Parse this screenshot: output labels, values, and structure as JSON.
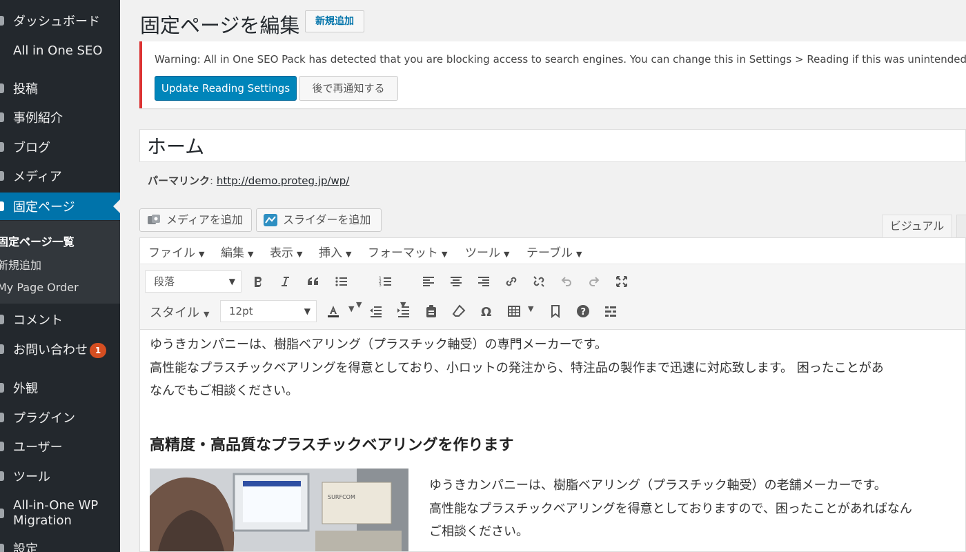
{
  "sidebar": {
    "items": [
      {
        "label": "ダッシュボード"
      },
      {
        "label": "All in One SEO"
      },
      {
        "label": "投稿"
      },
      {
        "label": "事例紹介"
      },
      {
        "label": "ブログ"
      },
      {
        "label": "メディア"
      },
      {
        "label": "固定ページ"
      },
      {
        "label": "コメント"
      },
      {
        "label": "お問い合わせ"
      },
      {
        "label": "外観"
      },
      {
        "label": "プラグイン"
      },
      {
        "label": "ユーザー"
      },
      {
        "label": "ツール"
      },
      {
        "label": "All-in-One WP Migration"
      },
      {
        "label": "設定"
      }
    ],
    "submenu": [
      "固定ページ一覧",
      "新規追加",
      "My Page Order"
    ],
    "badge": "1",
    "active_color": "#0073aa",
    "bg_color": "#23282d"
  },
  "header": {
    "title": "固定ページを編集",
    "add_new": "新規追加"
  },
  "notice": {
    "text": "Warning: All in One SEO Pack has detected that you are blocking access to search engines. You can change this in Settings > Reading if this was unintended.",
    "primary_button": "Update Reading Settings",
    "secondary_button": "後で再通知する",
    "border_color": "#dc3232"
  },
  "post": {
    "title": "ホーム",
    "permalink_label": "パーマリンク",
    "permalink_url": "http://demo.proteg.jp/wp/"
  },
  "media_buttons": {
    "add_media": "メディアを追加",
    "add_slider": "スライダーを追加"
  },
  "editor_tabs": {
    "visual": "ビジュアル"
  },
  "menubar": [
    "ファイル",
    "編集",
    "表示",
    "挿入",
    "フォーマット",
    "ツール",
    "テーブル"
  ],
  "toolbar": {
    "format_select": "段落",
    "style_label": "スタイル",
    "font_size": "12pt",
    "row1_icons": [
      "bold-icon",
      "italic-icon",
      "blockquote-icon",
      "bullet-list-icon",
      "numbered-list-icon",
      "align-left-icon",
      "align-center-icon",
      "align-right-icon",
      "link-icon",
      "unlink-icon",
      "undo-icon",
      "redo-icon",
      "fullscreen-icon"
    ],
    "row2_icons": [
      "text-color-icon",
      "outdent-icon",
      "indent-icon",
      "paste-text-icon",
      "clear-formatting-icon",
      "special-character-icon",
      "table-icon",
      "anchor-icon",
      "help-icon",
      "toolbar-toggle-icon"
    ]
  },
  "content": {
    "paragraph_1": "ゆうきカンパニーは、樹脂ベアリング（プラスチック軸受）の専門メーカーです。",
    "paragraph_2": "高性能なプラスチックベアリングを得意としており、小ロットの発注から、特注品の製作まで迅速に対応致します。 困ったことがあ",
    "paragraph_3": "なんでもご相談ください。",
    "heading": "高精度・高品質なプラスチックベアリングを作ります",
    "side_1": "ゆうきカンパニーは、樹脂ベアリング（プラスチック軸受）の老舗メーカーです。",
    "side_2": "高性能なプラスチックベアリングを得意としておりますので、困ったことがあればなん",
    "side_3": "ご相談ください。",
    "image_label": "SURFCOM"
  }
}
